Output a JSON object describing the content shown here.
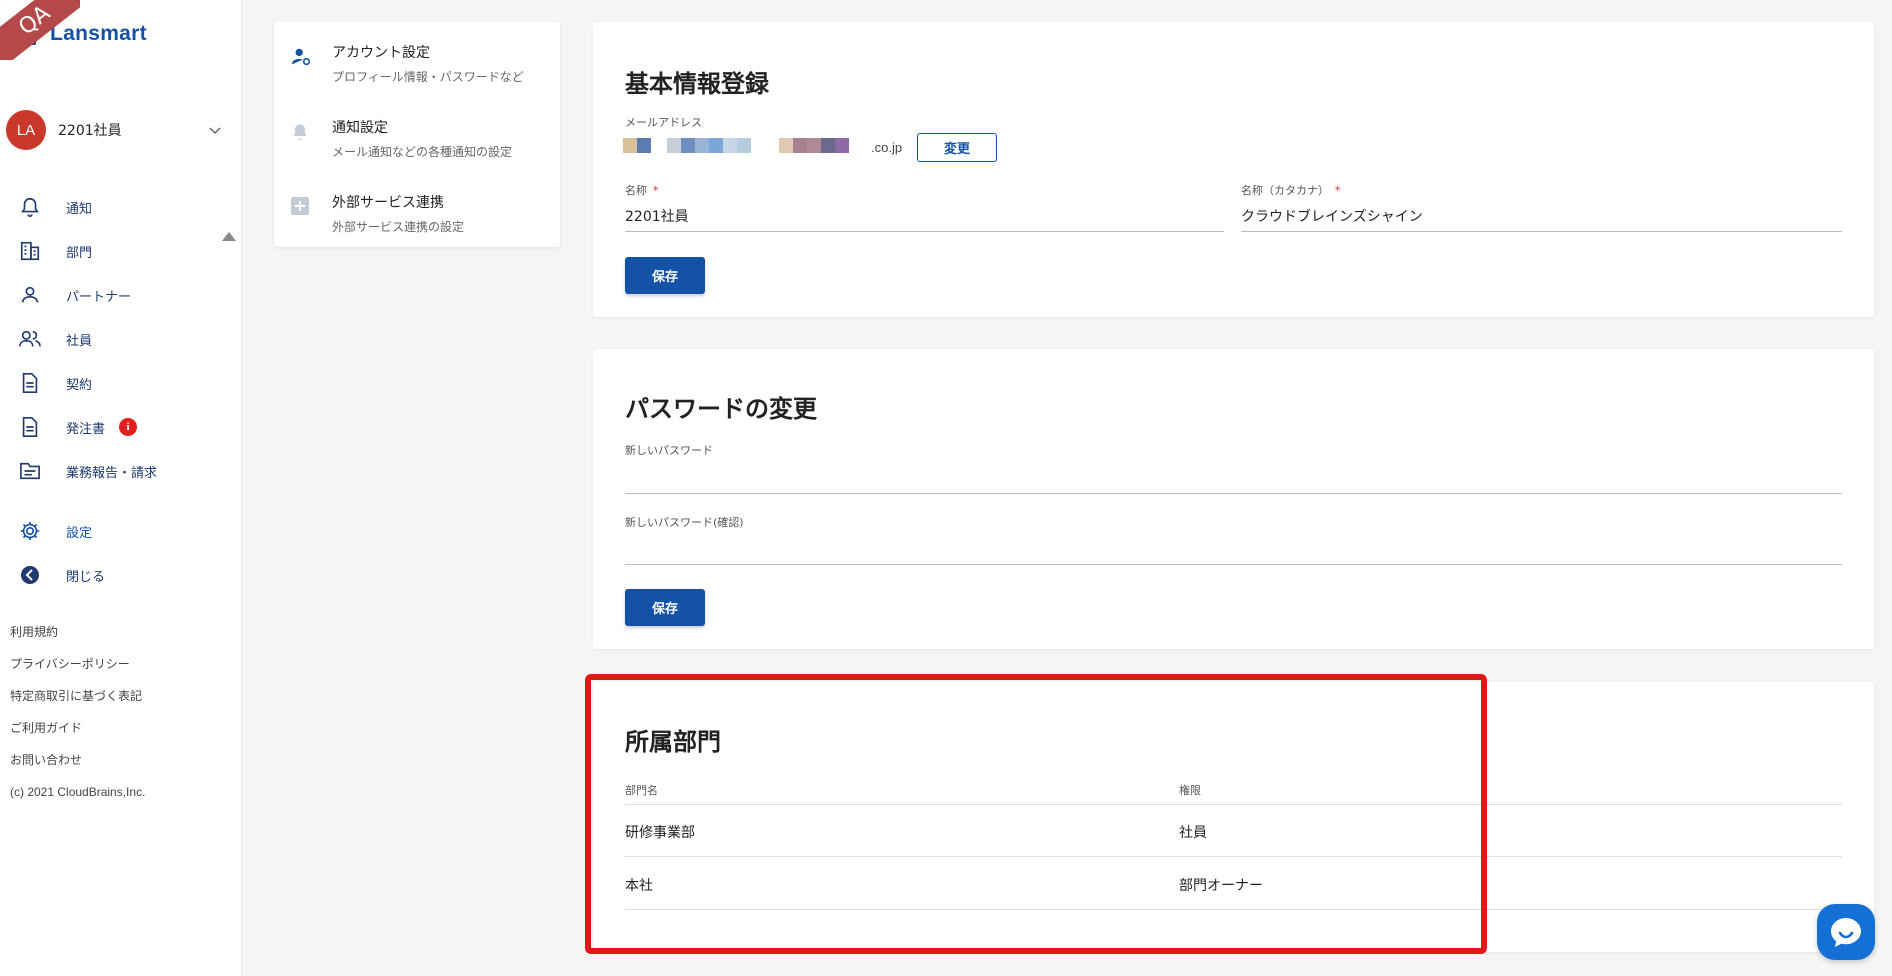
{
  "brand": {
    "name": "Lansmart",
    "env_ribbon": "QA"
  },
  "user": {
    "initials": "LA",
    "name": "2201社員"
  },
  "nav": [
    {
      "label": "通知",
      "icon": "bell-icon"
    },
    {
      "label": "部門",
      "icon": "building-icon"
    },
    {
      "label": "パートナー",
      "icon": "person-icon"
    },
    {
      "label": "社員",
      "icon": "people-icon"
    },
    {
      "label": "契約",
      "icon": "document-icon"
    },
    {
      "label": "発注書",
      "icon": "document-icon",
      "badge": "i"
    },
    {
      "label": "業務報告・請求",
      "icon": "folder-icon"
    },
    {
      "label": "設定",
      "icon": "gear-icon"
    },
    {
      "label": "閉じる",
      "icon": "arrow-left-circle-icon"
    }
  ],
  "footer_links": [
    "利用規約",
    "プライバシーポリシー",
    "特定商取引に基づく表記",
    "ご利用ガイド",
    "お問い合わせ"
  ],
  "copyright": "(c) 2021 CloudBrains,Inc.",
  "settings_menu": [
    {
      "title": "アカウント設定",
      "subtitle": "プロフィール情報・パスワードなど",
      "icon": "account-settings-icon"
    },
    {
      "title": "通知設定",
      "subtitle": "メール通知などの各種通知の設定",
      "icon": "bell-icon"
    },
    {
      "title": "外部サービス連携",
      "subtitle": "外部サービス連携の設定",
      "icon": "plus-box-icon"
    }
  ],
  "basic_info": {
    "title": "基本情報登録",
    "email_label": "メールアドレス",
    "email_domain": ".co.jp",
    "change_button": "変更",
    "name_label": "名称",
    "name_value": "2201社員",
    "kana_label": "名称（カタカナ）",
    "kana_value": "クラウドブレインズシャイン",
    "required_mark": "*",
    "save_button": "保存"
  },
  "password": {
    "title": "パスワードの変更",
    "new_label": "新しいパスワード",
    "confirm_label": "新しいパスワード(確認)",
    "save_button": "保存"
  },
  "departments": {
    "title": "所属部門",
    "columns": [
      "部門名",
      "権限"
    ],
    "rows": [
      {
        "name": "研修事業部",
        "role": "社員"
      },
      {
        "name": "本社",
        "role": "部門オーナー"
      }
    ]
  },
  "colors": {
    "primary": "#1452a8",
    "nav_text": "#1f3a70",
    "avatar": "#c9382b",
    "highlight": "#e01818",
    "badge": "#e02020",
    "chat": "#1570d6"
  }
}
